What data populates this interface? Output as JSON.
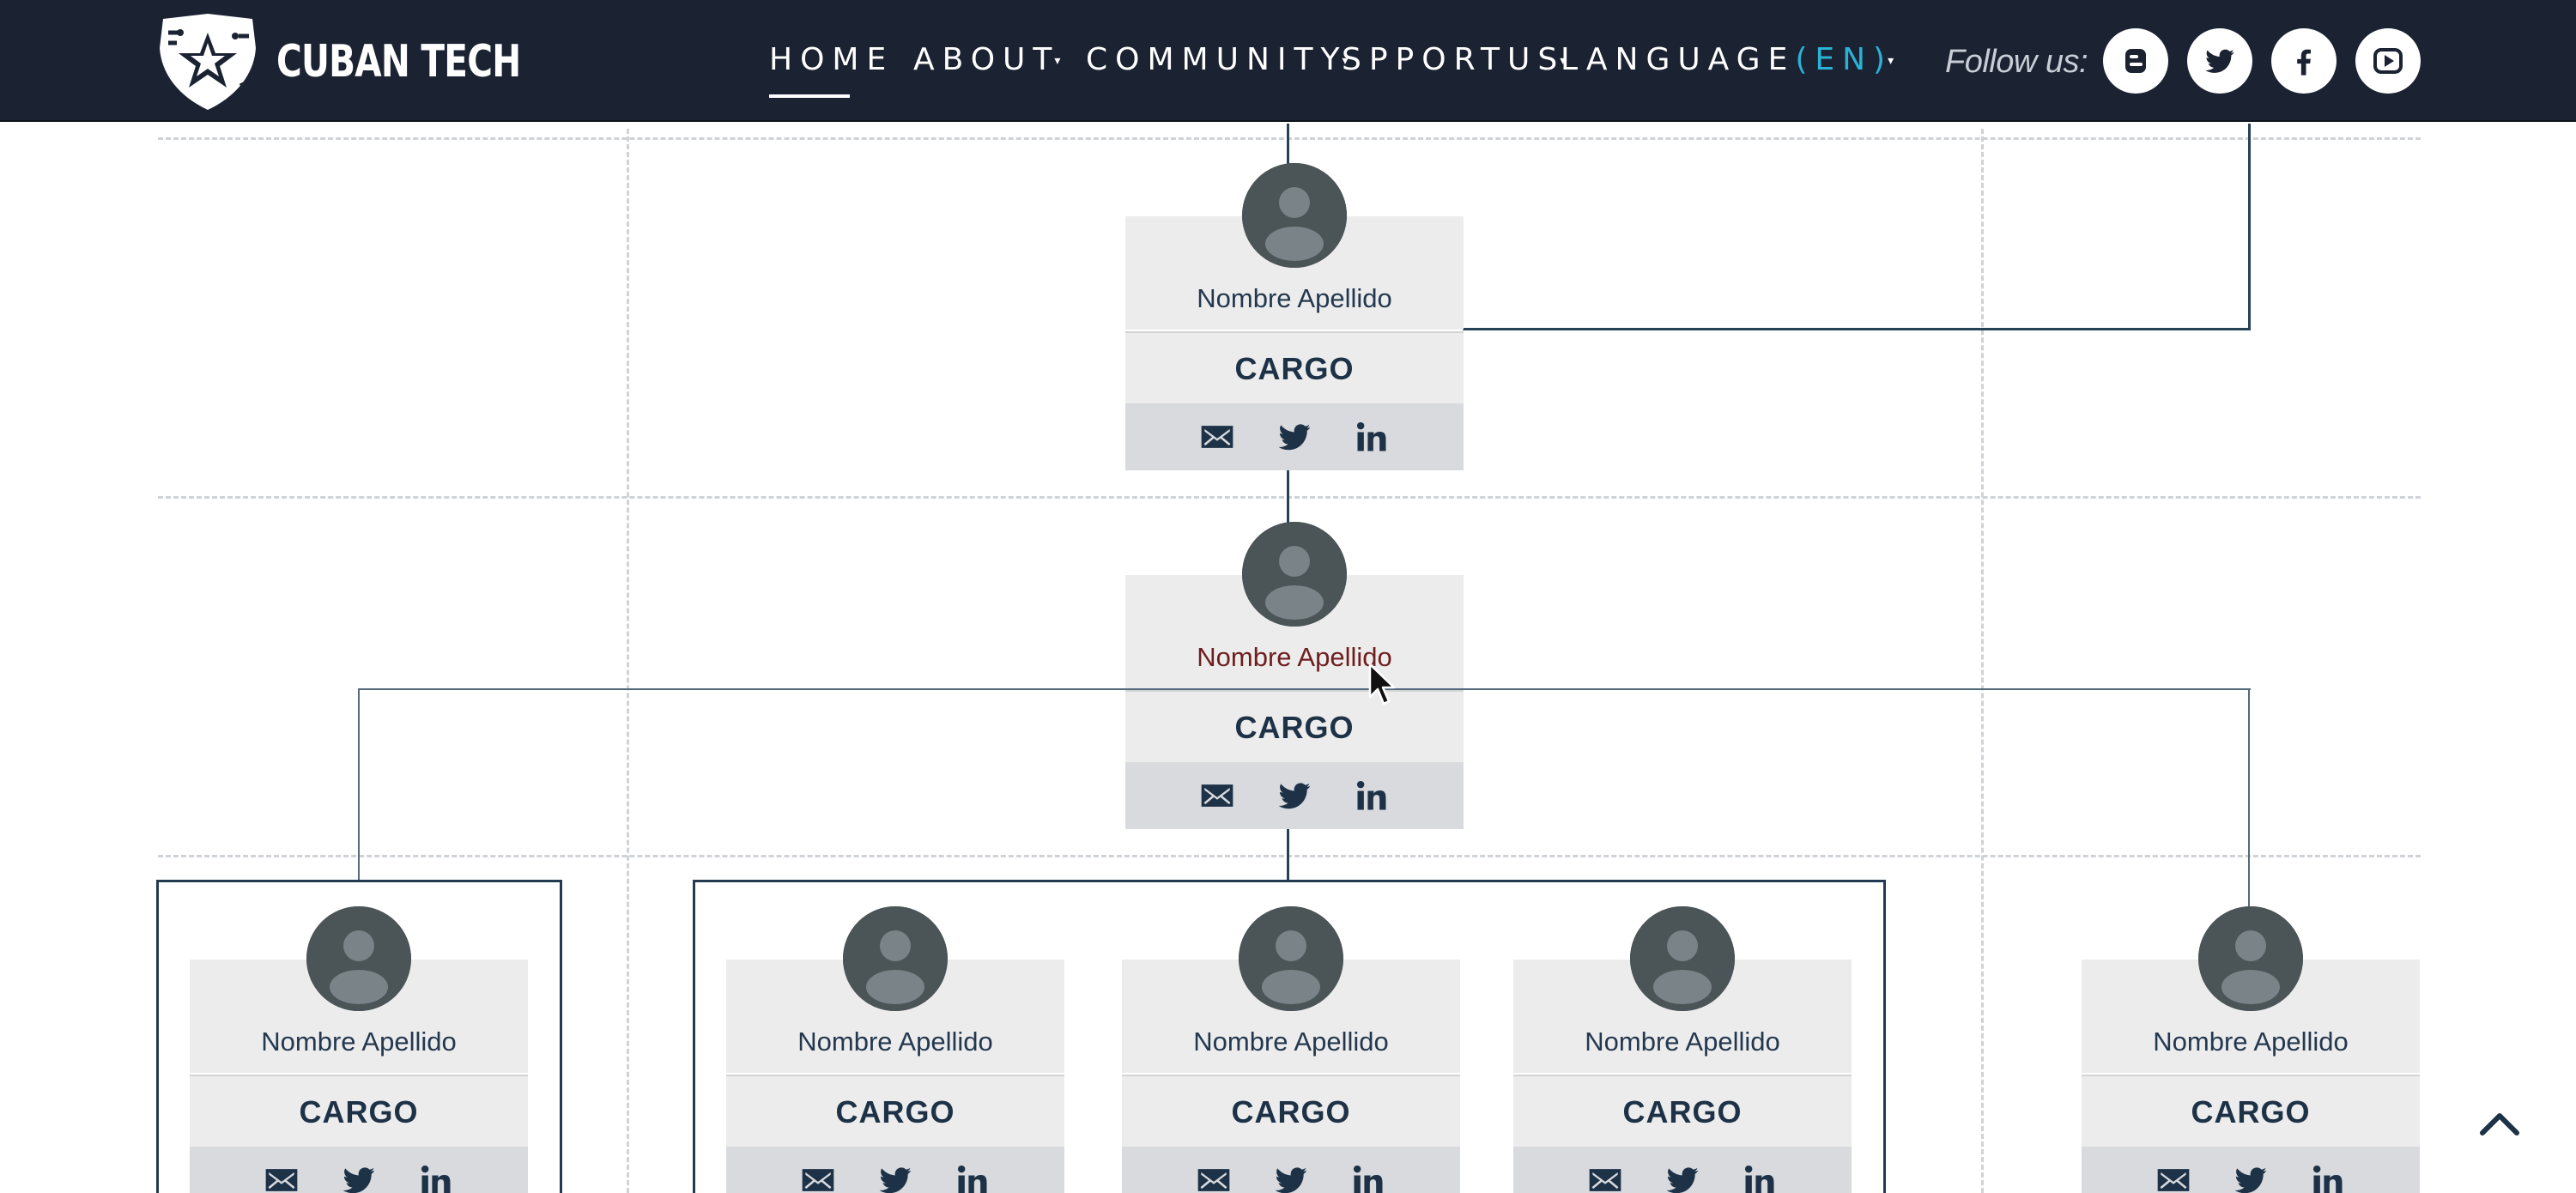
{
  "header": {
    "logo_text": "CUBAN TECH",
    "nav": [
      {
        "label": "HOME",
        "active": true
      },
      {
        "label": "ABOUT",
        "dropdown": true
      },
      {
        "label": "COMMUNITY",
        "dropdown": true
      },
      {
        "label": "SPPORTUS",
        "dropdown": true
      },
      {
        "label": "LANGUAGE",
        "suffix": "(EN)",
        "dropdown": true
      }
    ],
    "follow_label": "Follow us:",
    "social": [
      "blogger-icon",
      "twitter-icon",
      "facebook-icon",
      "youtube-icon"
    ]
  },
  "cards": {
    "level1": {
      "name": "Nombre Apellido",
      "role": "CARGO"
    },
    "level2": {
      "name": "Nombre Apellido",
      "role": "CARGO"
    },
    "level3": [
      {
        "name": "Nombre Apellido",
        "role": "CARGO"
      },
      {
        "name": "Nombre Apellido",
        "role": "CARGO"
      },
      {
        "name": "Nombre Apellido",
        "role": "CARGO"
      },
      {
        "name": "Nombre Apellido",
        "role": "CARGO"
      },
      {
        "name": "Nombre Apellido",
        "role": "CARGO"
      }
    ]
  },
  "colors": {
    "header_bg": "#1b2332",
    "accent": "#2ab3d6",
    "name_text": "#23384f",
    "hover_name_text": "#6e1e1e",
    "connector": "#264257"
  }
}
